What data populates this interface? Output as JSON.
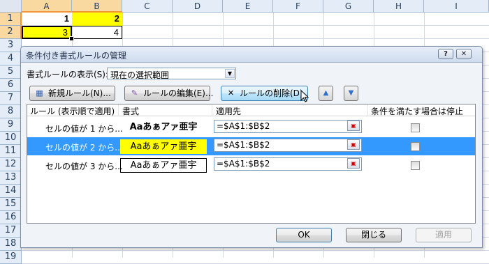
{
  "sheet": {
    "columns": [
      "A",
      "B",
      "C",
      "D",
      "E",
      "F",
      "G",
      "H",
      "I"
    ],
    "rows": [
      "1",
      "2",
      "3",
      "4",
      "5",
      "6",
      "7",
      "8",
      "9",
      "10",
      "11",
      "12",
      "13",
      "14",
      "15",
      "16",
      "17",
      "18",
      "19"
    ],
    "cells": {
      "A1": "1",
      "B1": "2",
      "A2": "3",
      "B2": "4"
    },
    "highlight_color": "#ffff00"
  },
  "dialog": {
    "title": "条件付き書式ルールの管理",
    "help_label": "?",
    "close_label": "✕",
    "show_rules_label": "書式ルールの表示(S):",
    "show_rules_value": "現在の選択範囲",
    "toolbar": {
      "new_rule": "新規ルール(N)...",
      "edit_rule": "ルールの編集(E)...",
      "delete_rule": "ルールの削除(D)",
      "move_up": "▲",
      "move_down": "▼"
    },
    "columns": {
      "rule": "ルール (表示順で適用)",
      "format": "書式",
      "applies_to": "適用先",
      "stop_if_true": "条件を満たす場合は停止"
    },
    "rules": [
      {
        "name": "セルの値が 1 から...",
        "preview": "Aaあぁアァ亜宇",
        "applies_to": "=$A$1:$B$2",
        "selected": false
      },
      {
        "name": "セルの値が 2 から...",
        "preview": "Aaあぁアァ亜宇",
        "applies_to": "=$A$1:$B$2",
        "selected": true
      },
      {
        "name": "セルの値が 3 から...",
        "preview": "Aaあぁアァ亜宇",
        "applies_to": "=$A$1:$B$2",
        "selected": false
      }
    ],
    "buttons": {
      "ok": "OK",
      "close": "閉じる",
      "apply": "適用"
    }
  },
  "colors": {
    "selection": "#3399ff",
    "accent": "#f29536",
    "preview_highlight": "#ffff00"
  }
}
